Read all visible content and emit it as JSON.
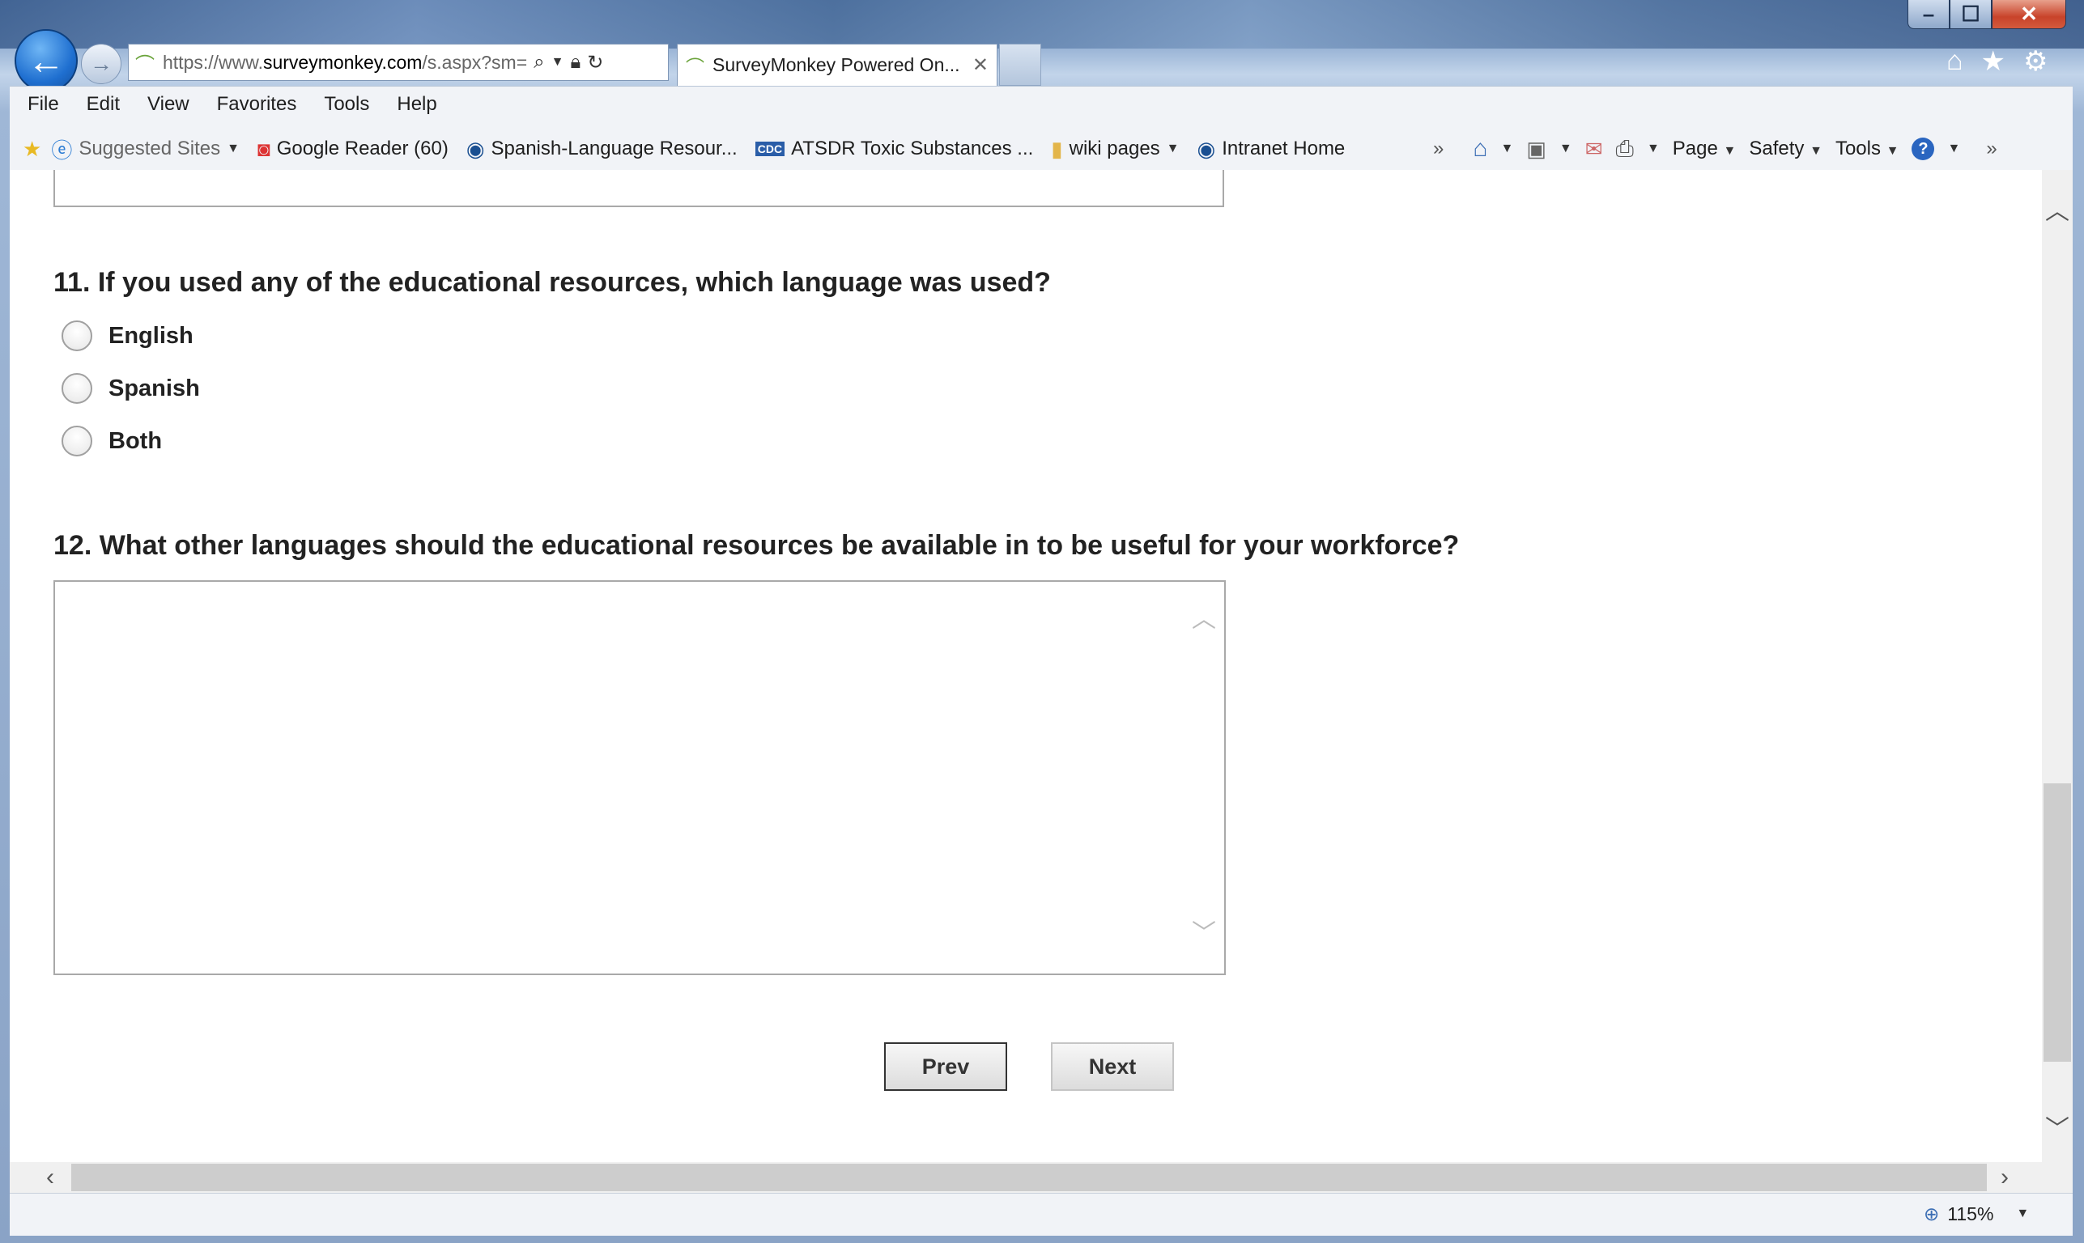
{
  "browser": {
    "address": {
      "prefix": "https://www.",
      "domain": "surveymonkey.com",
      "path": "/s.aspx?sm="
    },
    "tab": {
      "title": "SurveyMonkey Powered On...",
      "close": "✕"
    },
    "window_controls": {
      "minimize": "–",
      "maximize": "☐",
      "close": "✕"
    }
  },
  "menu": {
    "items": [
      "File",
      "Edit",
      "View",
      "Favorites",
      "Tools",
      "Help"
    ]
  },
  "favorites": {
    "items": [
      {
        "label": "Suggested Sites",
        "icon": "ie-page-icon"
      },
      {
        "label": "Google Reader (60)",
        "icon": "google-reader-icon"
      },
      {
        "label": "Spanish-Language Resour...",
        "icon": "globe-icon"
      },
      {
        "label": "ATSDR Toxic Substances ...",
        "icon": "cdc-icon"
      },
      {
        "label": "wiki pages",
        "icon": "folder-icon"
      },
      {
        "label": "Intranet Home",
        "icon": "globe-icon"
      }
    ],
    "overflow": "»"
  },
  "command_bar": {
    "page": "Page",
    "safety": "Safety",
    "tools": "Tools",
    "overflow": "»"
  },
  "survey": {
    "q11": {
      "text": "11. If you used any of the educational resources, which language was used?",
      "options": [
        "English",
        "Spanish",
        "Both"
      ]
    },
    "q12": {
      "text": "12. What other languages should the educational resources be available in to be useful for your workforce?",
      "answer": ""
    },
    "buttons": {
      "prev": "Prev",
      "next": "Next"
    }
  },
  "status": {
    "zoom": "115%"
  },
  "colors": {
    "back_button": "#1f6fd0",
    "close_button": "#c8432a"
  }
}
